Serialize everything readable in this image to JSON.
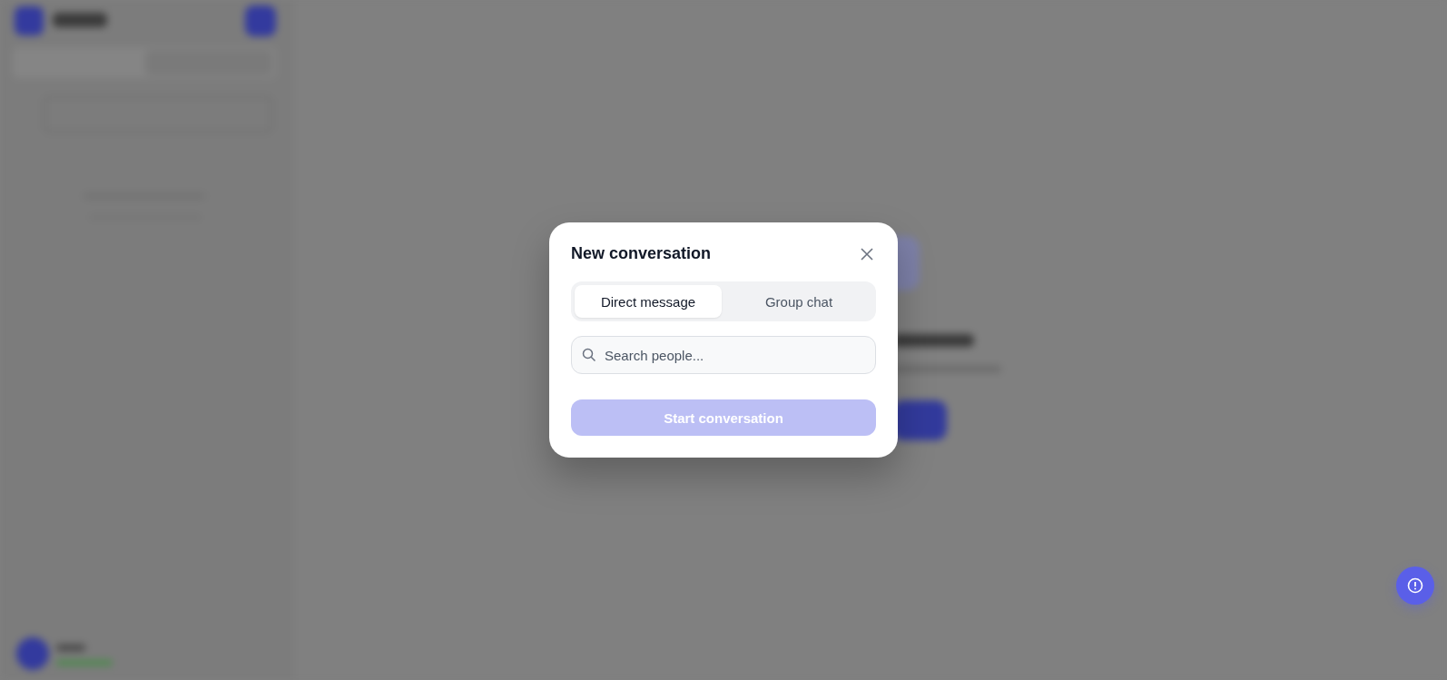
{
  "dialog": {
    "title": "New conversation",
    "tabs": [
      {
        "label": "Direct message",
        "selected": true
      },
      {
        "label": "Group chat",
        "selected": false
      }
    ],
    "search": {
      "placeholder": "Search people..."
    },
    "submit": {
      "label": "Start conversation",
      "disabled": true
    }
  }
}
